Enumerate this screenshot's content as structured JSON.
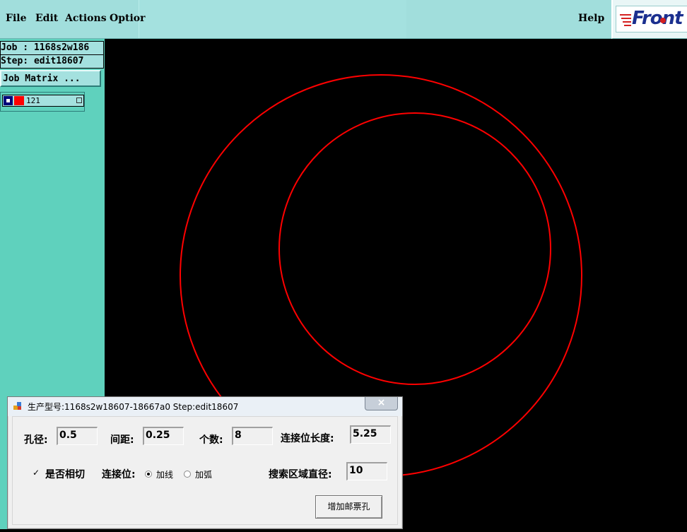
{
  "menubar": {
    "file": "File",
    "edit": "Edit",
    "actions": "Actions",
    "options": "Optior",
    "help": "Help"
  },
  "logo": {
    "text": "Front"
  },
  "left_panel": {
    "job_line": "Job : 1168s2w186",
    "step_line": "Step: edit18607",
    "job_matrix_label": "Job Matrix ...",
    "layer": {
      "name": "121",
      "color": "#ff0000",
      "checked": true
    }
  },
  "dialog": {
    "title": "生产型号:1168s2w18607-18667a0 Step:edit18607",
    "close_label": "×",
    "hole_diameter_label": "孔径:",
    "hole_diameter_value": "0.5",
    "spacing_label": "间距:",
    "spacing_value": "0.25",
    "count_label": "个数:",
    "count_value": "8",
    "connection_length_label": "连接位长度:",
    "connection_length_value": "5.25",
    "tangent_check": "✓",
    "tangent_label": "是否相切",
    "connection_label": "连接位:",
    "option_line": "加线",
    "option_arc": "加弧",
    "selected_option": "加线",
    "search_diameter_label": "搜索区域直径:",
    "search_diameter_value": "10",
    "add_button": "增加邮票孔"
  },
  "colors": {
    "menubar_bg": "#a1dedc",
    "panel_bg": "#5fd1bd",
    "canvas_bg": "#000000",
    "circle_stroke": "#ff0000"
  }
}
